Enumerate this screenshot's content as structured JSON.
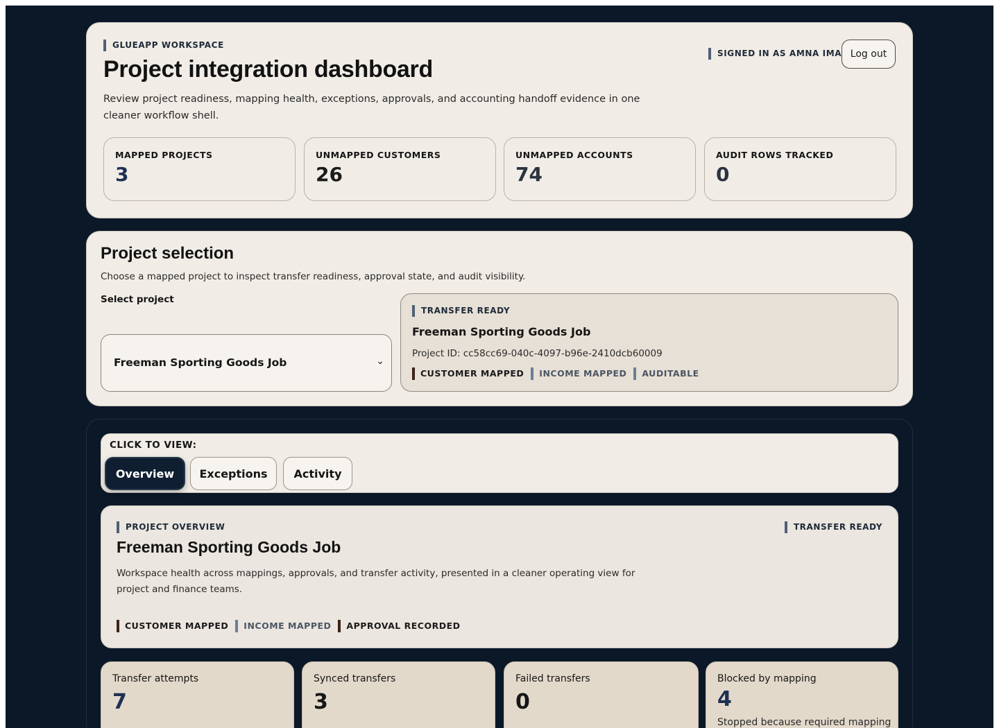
{
  "header": {
    "eyebrow": "GLUEAPP WORKSPACE",
    "title": "Project integration dashboard",
    "description": "Review project readiness, mapping health, exceptions, approvals, and accounting handoff evidence in one cleaner workflow shell.",
    "signed_in": "SIGNED IN AS AMNA IMAM",
    "logout_label": "Log out",
    "stats": [
      {
        "label": "MAPPED PROJECTS",
        "value": "3"
      },
      {
        "label": "UNMAPPED CUSTOMERS",
        "value": "26"
      },
      {
        "label": "UNMAPPED ACCOUNTS",
        "value": "74"
      },
      {
        "label": "AUDIT ROWS TRACKED",
        "value": "0"
      }
    ]
  },
  "selection": {
    "title": "Project selection",
    "description": "Choose a mapped project to inspect transfer readiness, approval state, and audit visibility.",
    "select_label": "Select project",
    "selected_value": "Freeman Sporting Goods Job",
    "status": "TRANSFER READY",
    "project_name": "Freeman Sporting Goods Job",
    "project_id": "Project ID: cc58cc69-040c-4097-b96e-2410dcb60009",
    "tags": [
      "CUSTOMER MAPPED",
      "INCOME MAPPED",
      "AUDITABLE"
    ]
  },
  "tabs": {
    "label": "CLICK TO VIEW:",
    "items": [
      "Overview",
      "Exceptions",
      "Activity"
    ],
    "active": "Overview"
  },
  "overview": {
    "eyebrow": "PROJECT OVERVIEW",
    "status": "TRANSFER READY",
    "title": "Freeman Sporting Goods Job",
    "description": "Workspace health across mappings, approvals, and transfer activity, presented in a cleaner operating view for project and finance teams.",
    "tags": [
      "CUSTOMER MAPPED",
      "INCOME MAPPED",
      "APPROVAL RECORDED"
    ]
  },
  "metrics": [
    {
      "label": "Transfer attempts",
      "value": "7"
    },
    {
      "label": "Synced transfers",
      "value": "3"
    },
    {
      "label": "Failed transfers",
      "value": "0"
    },
    {
      "label": "Blocked by mapping",
      "value": "4",
      "note": "Stopped because required mapping"
    }
  ],
  "colors": {
    "background": "#0b1828",
    "card": "#f1ede6",
    "accent_navy": "#1d3152",
    "active_tab": "#0f1e30"
  }
}
